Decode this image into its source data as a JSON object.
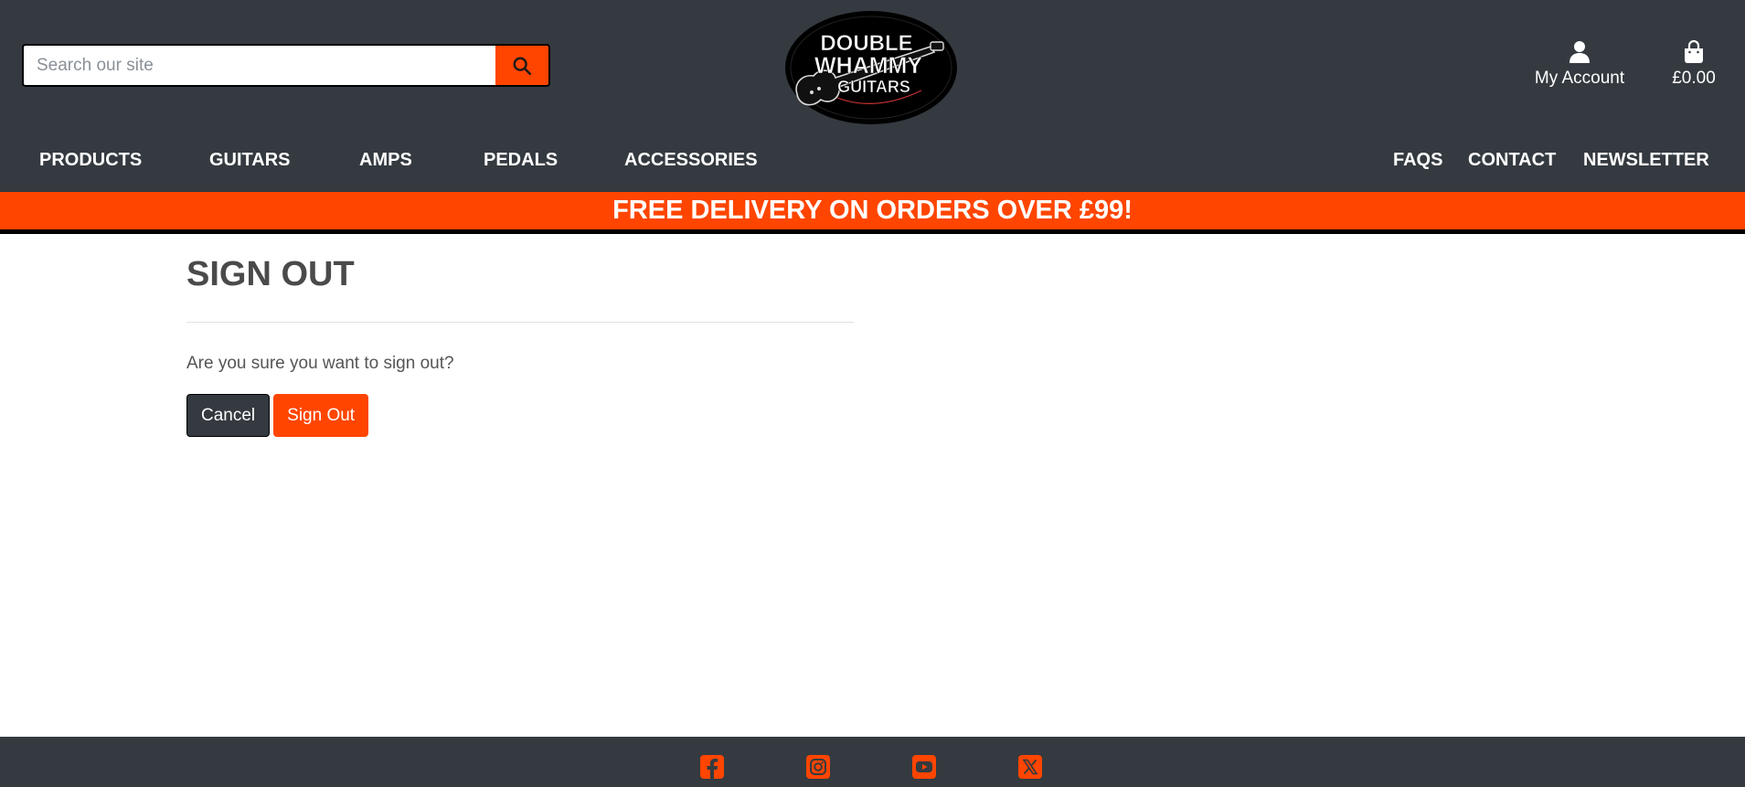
{
  "header": {
    "search": {
      "placeholder": "Search our site",
      "value": "",
      "button_icon": "search-icon"
    },
    "logo": {
      "line1": "DOUBLE",
      "line2": "WHAMMY",
      "line3": "GUITARS"
    },
    "account": {
      "icon": "user-icon",
      "label": "My Account"
    },
    "bag": {
      "icon": "shopping-bag-icon",
      "total": "£0.00"
    }
  },
  "nav": {
    "left": [
      "PRODUCTS",
      "GUITARS",
      "AMPS",
      "PEDALS",
      "ACCESSORIES"
    ],
    "right": [
      "FAQS",
      "CONTACT",
      "NEWSLETTER"
    ]
  },
  "banner": {
    "text": "FREE DELIVERY ON ORDERS OVER £99!"
  },
  "main": {
    "title": "SIGN OUT",
    "question": "Are you sure you want to sign out?",
    "cancel_label": "Cancel",
    "signout_label": "Sign Out"
  },
  "footer": {
    "social": [
      "facebook-icon",
      "instagram-icon",
      "youtube-icon",
      "x-icon"
    ]
  },
  "colors": {
    "header_bg": "#343a40",
    "accent": "#ff4500",
    "text_dark": "#4a4a4a"
  }
}
